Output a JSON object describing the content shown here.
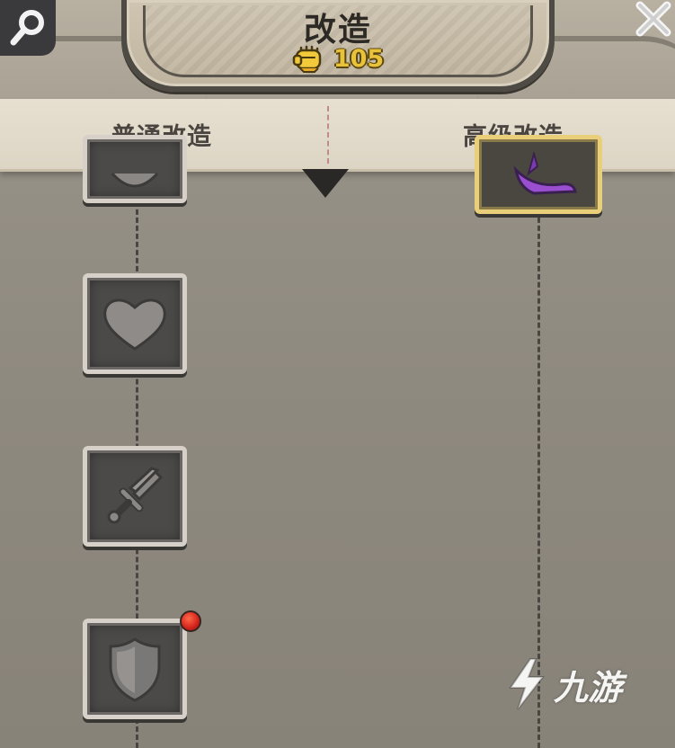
{
  "header": {
    "title": "改造",
    "currency": {
      "icon": "fist-icon",
      "value": "105"
    }
  },
  "tabs": [
    {
      "label": "普通改造",
      "active": true
    },
    {
      "label": "高级改造",
      "active": false
    }
  ],
  "tracks": {
    "normal": [
      {
        "icon": "heart-icon",
        "state": "partially-visible"
      },
      {
        "icon": "heart-icon",
        "state": "locked"
      },
      {
        "icon": "sword-icon",
        "state": "locked"
      },
      {
        "icon": "shield-icon",
        "state": "locked",
        "notification": true
      }
    ],
    "advanced": [
      {
        "icon": "purple-item-icon",
        "state": "partially-visible",
        "frame": "gold"
      }
    ]
  },
  "watermark": {
    "text": "九游"
  },
  "colors": {
    "background": "#8f8a80",
    "tab_bar": "#e3dccc",
    "currency": "#e8c33a",
    "notification": "#d2221a",
    "gold_frame": "#e9cf7a"
  }
}
